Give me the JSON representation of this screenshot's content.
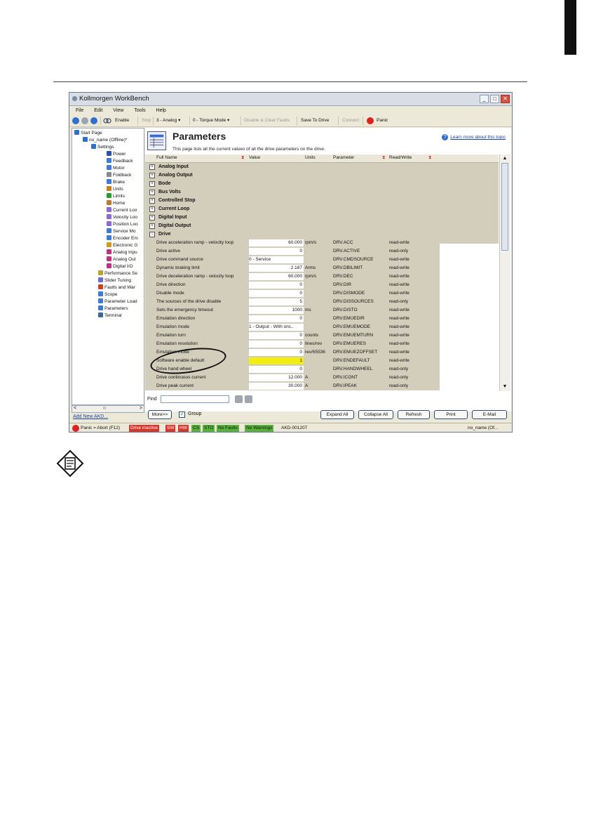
{
  "window": {
    "title": "Kollmorgen WorkBench",
    "controls": [
      "_",
      "□",
      "✕"
    ]
  },
  "menu": [
    "File",
    "Edit",
    "View",
    "Tools",
    "Help"
  ],
  "toolbar": {
    "enable": "Enable",
    "stop": "Stop",
    "analog": "3 - Analog ▾",
    "torque": "0 - Torque Mode ▾",
    "disable_clear": "Disable & Clear Faults",
    "save": "Save To Drive",
    "connect": "Connect",
    "panic": "Panic"
  },
  "tree": [
    {
      "label": "Start Page",
      "color": "#2f6fd0"
    },
    {
      "label": "no_name (Offline)*",
      "color": "#2f6fd0"
    },
    {
      "label": "Settings",
      "color": "#2f6fd0"
    },
    {
      "label": "Power",
      "color": "#2f4fb0"
    },
    {
      "label": "Feedback",
      "color": "#3a7ad8"
    },
    {
      "label": "Motor",
      "color": "#3a7ad8"
    },
    {
      "label": "Foldback",
      "color": "#8a8a8a"
    },
    {
      "label": "Brake",
      "color": "#3a7ad8"
    },
    {
      "label": "Units",
      "color": "#c77f20"
    },
    {
      "label": "Limits",
      "color": "#2a9a2a"
    },
    {
      "label": "Home",
      "color": "#c07a30"
    },
    {
      "label": "Current Loo",
      "color": "#8a6ad0"
    },
    {
      "label": "Velocity Loo",
      "color": "#8a6ad0"
    },
    {
      "label": "Position Loo",
      "color": "#8a6ad0"
    },
    {
      "label": "Service Mo",
      "color": "#3a7ad8"
    },
    {
      "label": "Encoder Em",
      "color": "#3a7ad8"
    },
    {
      "label": "Electronic G",
      "color": "#d09a20"
    },
    {
      "label": "Analog Inpu",
      "color": "#c03080"
    },
    {
      "label": "Analog Out",
      "color": "#c03080"
    },
    {
      "label": "Digital I/O",
      "color": "#c03080"
    },
    {
      "label": "Performance Se",
      "color": "#c0a030"
    },
    {
      "label": "Slider Tuning",
      "color": "#6a6ad0"
    },
    {
      "label": "Faults and War",
      "color": "#d04020"
    },
    {
      "label": "Scope",
      "color": "#3a7ad8"
    },
    {
      "label": "Parameter Load",
      "color": "#3a7ad8"
    },
    {
      "label": "Parameters",
      "color": "#3a7ad8"
    },
    {
      "label": "Terminal",
      "color": "#3a6a9a"
    }
  ],
  "add_new": "Add New AKD...",
  "tree_scroll_mark": "III",
  "page": {
    "title": "Parameters",
    "subtitle": "This page lists all the current values of all the drive parameters on the drive.",
    "learn_more": "Learn more about this topic"
  },
  "columns": {
    "name": "Full Name",
    "value": "Value",
    "units": "Units",
    "parameter": "Parameter",
    "rw": "Read/Write"
  },
  "groups": [
    "Analog Input",
    "Analog Output",
    "Bode",
    "Bus Volts",
    "Controlled Stop",
    "Current Loop",
    "Digital Input",
    "Digital Output",
    "Drive"
  ],
  "rows": [
    {
      "name": "Drive acceleration ramp - velocity loop",
      "value": "60.000",
      "units": "rpm/s",
      "param": "DRV.ACC",
      "rw": "read-write",
      "align": "num"
    },
    {
      "name": "Drive active",
      "value": "0",
      "units": "",
      "param": "DRV.ACTIVE",
      "rw": "read-only",
      "align": "num"
    },
    {
      "name": "Drive command source",
      "value": "0 - Service",
      "units": "",
      "param": "DRV.CMDSOURCE",
      "rw": "read-write",
      "align": "text"
    },
    {
      "name": "Dynamic braking limit",
      "value": "2.187",
      "units": "Arms",
      "param": "DRV.DBILIMIT",
      "rw": "read-write",
      "align": "num"
    },
    {
      "name": "Drive deceleration ramp - velocity loop",
      "value": "60.000",
      "units": "rpm/s",
      "param": "DRV.DEC",
      "rw": "read-write",
      "align": "num"
    },
    {
      "name": "Drive direction",
      "value": "0",
      "units": "",
      "param": "DRV.DIR",
      "rw": "read-write",
      "align": "num"
    },
    {
      "name": "Disable mode",
      "value": "0",
      "units": "",
      "param": "DRV.DISMODE",
      "rw": "read-write",
      "align": "num"
    },
    {
      "name": "The sources of the drive disable",
      "value": "5",
      "units": "",
      "param": "DRV.DISSOURCES",
      "rw": "read-only",
      "align": "num"
    },
    {
      "name": "Sets the emergency timeout",
      "value": "1000",
      "units": "ms",
      "param": "DRV.DISTO",
      "rw": "read-write",
      "align": "num"
    },
    {
      "name": "Emulation direction",
      "value": "0",
      "units": "",
      "param": "DRV.EMUEDIR",
      "rw": "read-write",
      "align": "num"
    },
    {
      "name": "Emulation mode",
      "value": "1 - Output - With onc..",
      "units": "",
      "param": "DRV.EMUEMODE",
      "rw": "read-write",
      "align": "text"
    },
    {
      "name": "Emulation turn",
      "value": "0",
      "units": "counts",
      "param": "DRV.EMUEMTURN",
      "rw": "read-write",
      "align": "num"
    },
    {
      "name": "Emulation resolution",
      "value": "0",
      "units": "lines/rev",
      "param": "DRV.EMUERES",
      "rw": "read-write",
      "align": "num"
    },
    {
      "name": "Emulation mode",
      "value": "0",
      "units": "rev/65536",
      "param": "DRV.EMUEZOFFSET",
      "rw": "read-write",
      "align": "num"
    },
    {
      "name": "Software enable default",
      "value": "1",
      "units": "",
      "param": "DRV.ENDEFAULT",
      "rw": "read-write",
      "align": "num",
      "highlight": true
    },
    {
      "name": "Drive hand wheel",
      "value": "0",
      "units": "",
      "param": "DRV.HANDWHEEL",
      "rw": "read-only",
      "align": "num"
    },
    {
      "name": "Drive continuous current",
      "value": "12.000",
      "units": "A",
      "param": "DRV.ICONT",
      "rw": "read-only",
      "align": "num"
    },
    {
      "name": "Drive peak current",
      "value": "30.000",
      "units": "A",
      "param": "DRV.IPEAK",
      "rw": "read-only",
      "align": "num"
    }
  ],
  "find": {
    "label": "Find"
  },
  "buttons": {
    "more": "More>>",
    "group": "Group",
    "expand": "Expand All",
    "collapse": "Collapse All",
    "refresh": "Refresh",
    "print": "Print",
    "email": "E-Mail"
  },
  "status": {
    "panic": "Panic = Abort (F12)",
    "drive_inactive": "Drive inactive",
    "sw": "SW",
    "hw": "HW",
    "cs": "CS",
    "sto": "STO",
    "no_faults": "No Faults",
    "no_warnings": "No Warnings",
    "device": "AKD-001207",
    "right": "no_name (Of..."
  }
}
